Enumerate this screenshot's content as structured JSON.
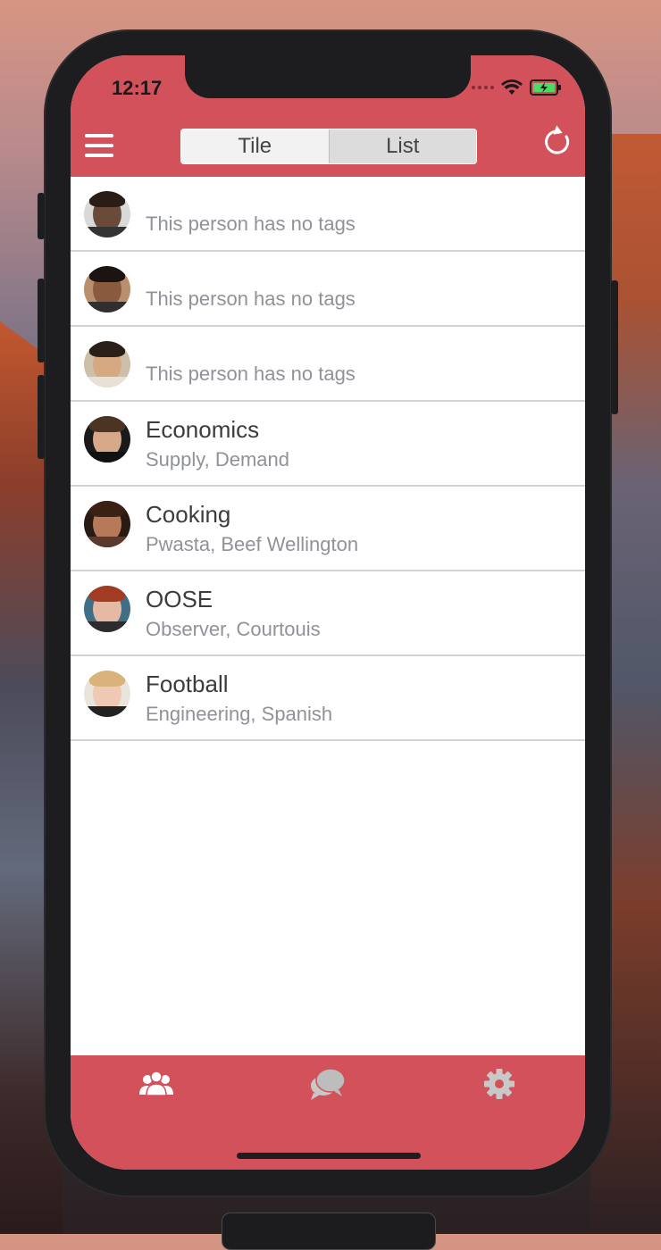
{
  "status_bar": {
    "time": "12:17"
  },
  "header": {
    "segments": [
      {
        "label": "Tile",
        "active": false
      },
      {
        "label": "List",
        "active": true
      }
    ],
    "icons": {
      "menu": "hamburger-icon",
      "refresh": "refresh-icon"
    }
  },
  "rows": [
    {
      "title": "",
      "subtitle": "This person has no tags"
    },
    {
      "title": "",
      "subtitle": "This person has no tags"
    },
    {
      "title": "",
      "subtitle": "This person has no tags"
    },
    {
      "title": "Economics",
      "subtitle": "Supply, Demand"
    },
    {
      "title": "Cooking",
      "subtitle": "Pwasta, Beef Wellington"
    },
    {
      "title": "OOSE",
      "subtitle": "Observer, Courtouis"
    },
    {
      "title": "Football",
      "subtitle": "Engineering, Spanish"
    }
  ],
  "tabbar": {
    "tabs": [
      {
        "icon": "people-icon",
        "active": true
      },
      {
        "icon": "chat-icon",
        "active": false
      },
      {
        "icon": "gear-icon",
        "active": false
      }
    ]
  },
  "colors": {
    "accent": "#d3515a",
    "subtitle": "#8f9298",
    "title": "#3c3c3c"
  }
}
